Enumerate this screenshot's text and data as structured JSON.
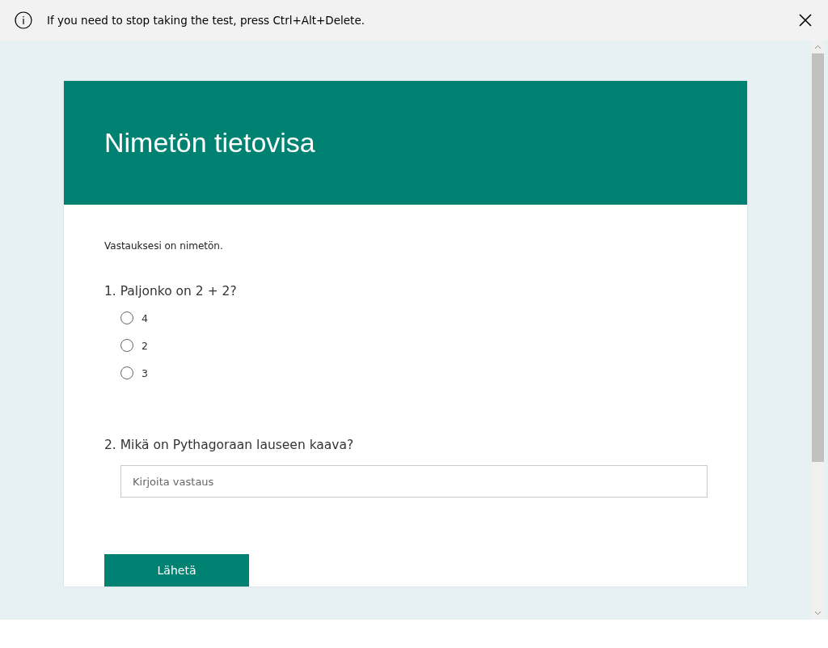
{
  "notice": {
    "text": "If you need to stop taking the test, press Ctrl+Alt+Delete."
  },
  "form": {
    "title": "Nimetön tietovisa",
    "note": "Vastauksesi on nimetön.",
    "questions": [
      {
        "kind": "choice",
        "title": "1. Paljonko on 2 + 2?",
        "options": [
          {
            "label": "4",
            "selected": false
          },
          {
            "label": "2",
            "selected": false
          },
          {
            "label": "3",
            "selected": false
          }
        ]
      },
      {
        "kind": "text",
        "title": "2. Mikä on Pythagoraan lauseen kaava?",
        "placeholder": "Kirjoita vastaus"
      }
    ],
    "submit": "Lähetä"
  }
}
